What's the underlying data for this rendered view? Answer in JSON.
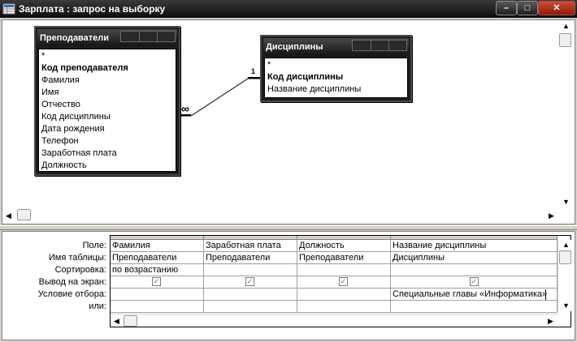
{
  "window": {
    "title": "Зарплата : запрос на выборку",
    "minimize_label": "–",
    "maximize_label": "□",
    "close_label": "✕"
  },
  "tables": [
    {
      "name": "Преподаватели",
      "fields": [
        {
          "label": "*",
          "key": false
        },
        {
          "label": "Код преподавателя",
          "key": true
        },
        {
          "label": "Фамилия",
          "key": false
        },
        {
          "label": "Имя",
          "key": false
        },
        {
          "label": "Отчество",
          "key": false
        },
        {
          "label": "Код дисциплины",
          "key": false
        },
        {
          "label": "Дата рождения",
          "key": false
        },
        {
          "label": "Телефон",
          "key": false
        },
        {
          "label": "Заработная плата",
          "key": false
        },
        {
          "label": "Должность",
          "key": false
        }
      ]
    },
    {
      "name": "Дисциплины",
      "fields": [
        {
          "label": "*",
          "key": false
        },
        {
          "label": "Код дисциплины",
          "key": true
        },
        {
          "label": "Название дисциплины",
          "key": false
        }
      ]
    }
  ],
  "relationship": {
    "one_side": "1",
    "many_side": "∞"
  },
  "grid": {
    "row_labels": [
      "Поле:",
      "Имя таблицы:",
      "Сортировка:",
      "Вывод на экран:",
      "Условие отбора:",
      "или:"
    ],
    "columns": [
      {
        "field": "Фамилия",
        "table": "Преподаватели",
        "sort": "по возрастанию",
        "show": true,
        "criteria": "",
        "or": ""
      },
      {
        "field": "Заработная плата",
        "table": "Преподаватели",
        "sort": "",
        "show": true,
        "criteria": "",
        "or": ""
      },
      {
        "field": "Должность",
        "table": "Преподаватели",
        "sort": "",
        "show": true,
        "criteria": "",
        "or": ""
      },
      {
        "field": "Название дисциплины",
        "table": "Дисциплины",
        "sort": "",
        "show": true,
        "criteria": "Специальные главы «Информатика»",
        "or": ""
      }
    ]
  }
}
